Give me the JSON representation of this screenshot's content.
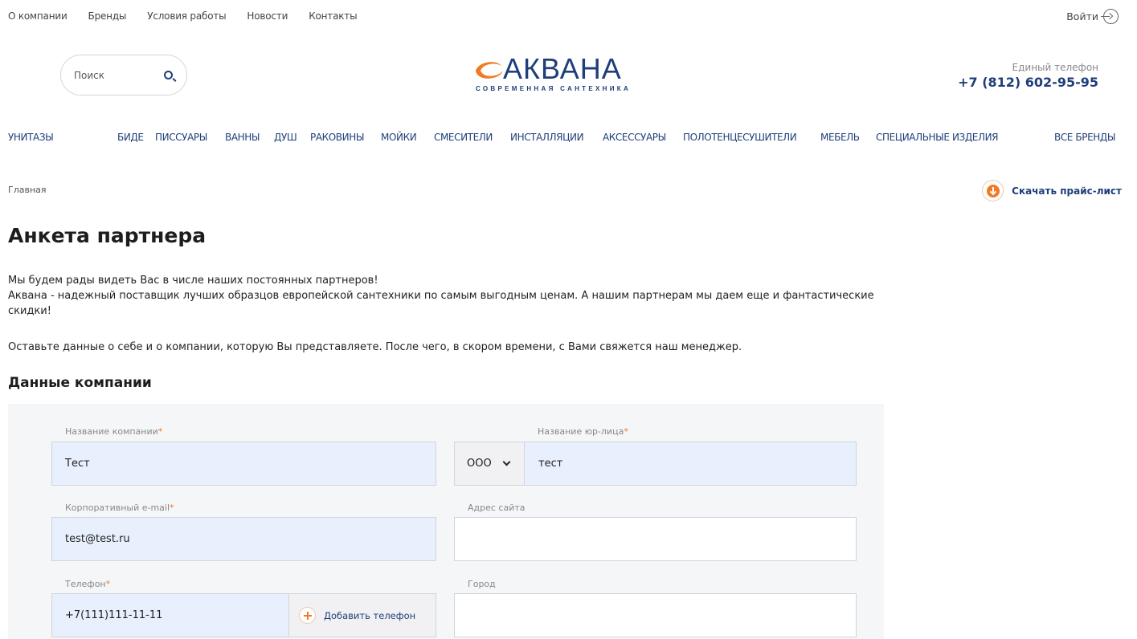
{
  "topnav": {
    "items": [
      "О компании",
      "Бренды",
      "Условия работы",
      "Новости",
      "Контакты"
    ],
    "login_label": "Войти"
  },
  "header": {
    "search_placeholder": "Поиск",
    "logo_text": "АКВАНА",
    "logo_tagline": "СОВРЕМЕННАЯ САНТЕХНИКА",
    "phone_label": "Единый телефон",
    "phone_number": "+7 (812) 602-95-95"
  },
  "catnav": {
    "items": [
      "УНИТАЗЫ",
      "БИДЕ",
      "ПИССУАРЫ",
      "ВАННЫ",
      "ДУШ",
      "РАКОВИНЫ",
      "МОЙКИ",
      "СМЕСИТЕЛИ",
      "ИНСТАЛЛЯЦИИ",
      "АКСЕССУАРЫ",
      "ПОЛОТЕНЦЕСУШИТЕЛИ",
      "МЕБЕЛЬ",
      "СПЕЦИАЛЬНЫЕ ИЗДЕЛИЯ",
      "ВСЕ БРЕНДЫ"
    ]
  },
  "breadcrumb": {
    "home": "Главная"
  },
  "price_list_label": "Скачать прайс-лист",
  "page": {
    "title": "Анкета партнера",
    "intro_line1": "Мы будем рады видеть Вас в числе наших постоянных партнеров!",
    "intro_line2": "Аквана - надежный поставщик лучших образцов европейской сантехники по самым выгодным ценам. А нашим партнерам мы даем еще и фантастические скидки!",
    "intro_line3": "Оставьте данные о себе и о компании, которую Вы представляете. После чего, в скором времени, с Вами свяжется наш менеджер.",
    "section_title": "Данные компании"
  },
  "form": {
    "company_name_label": "Название компании",
    "company_name_value": "Тест",
    "legal_name_label": "Название юр-лица",
    "legal_form_selected": "ООО",
    "legal_name_value": "тест",
    "email_label": "Корпоративный e-mail",
    "email_value": "test@test.ru",
    "website_label": "Адрес сайта",
    "website_value": "",
    "phone_label": "Телефон",
    "phone_value": "+7(111)111-11-11",
    "add_phone_label": "Добавить телефон",
    "city_label": "Город",
    "city_value": "",
    "required_mark": "*"
  },
  "colors": {
    "brand_blue": "#1f3f7a",
    "accent_orange": "#f07a23",
    "filled_field": "#e8effd"
  }
}
